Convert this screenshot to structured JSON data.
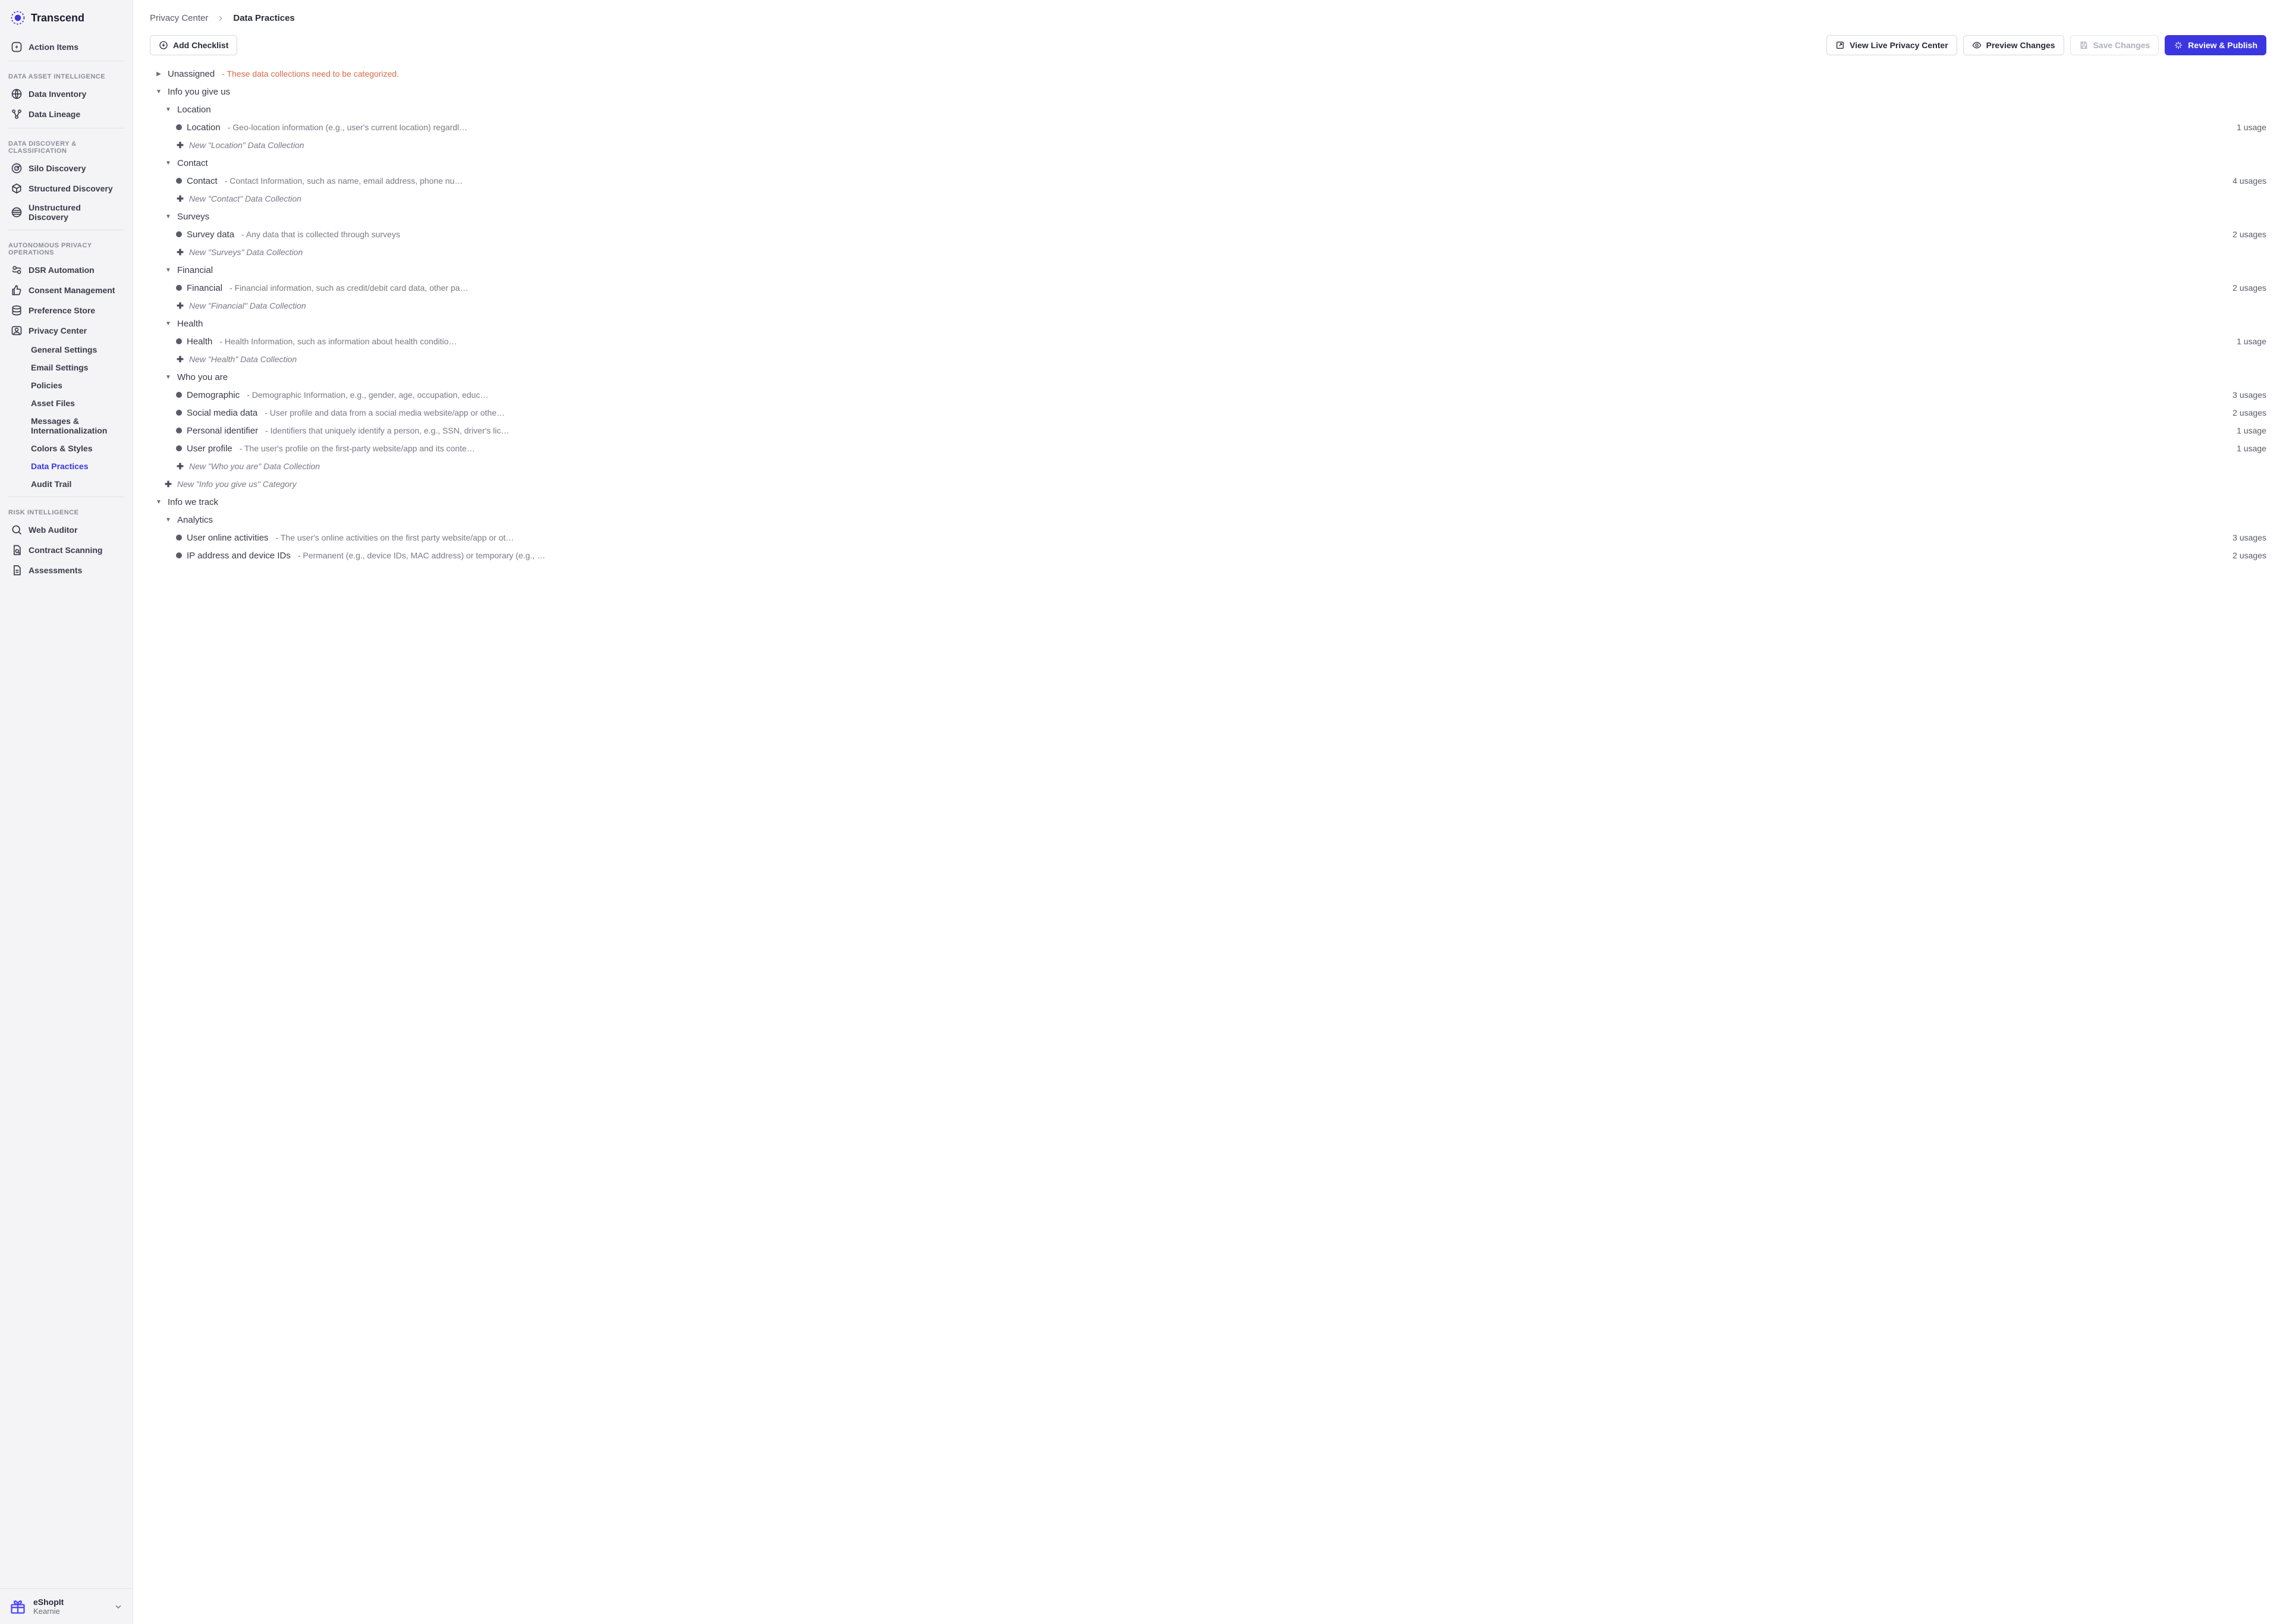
{
  "brand": "Transcend",
  "sidebar": {
    "action_items": "Action Items",
    "sections": [
      {
        "label": "DATA ASSET INTELLIGENCE",
        "items": [
          {
            "id": "data-inventory",
            "label": "Data Inventory"
          },
          {
            "id": "data-lineage",
            "label": "Data Lineage"
          }
        ]
      },
      {
        "label": "DATA DISCOVERY & CLASSIFICATION",
        "items": [
          {
            "id": "silo-discovery",
            "label": "Silo Discovery"
          },
          {
            "id": "structured-discovery",
            "label": "Structured Discovery"
          },
          {
            "id": "unstructured-discovery",
            "label": "Unstructured Discovery"
          }
        ]
      },
      {
        "label": "AUTONOMOUS PRIVACY OPERATIONS",
        "items": [
          {
            "id": "dsr-automation",
            "label": "DSR Automation"
          },
          {
            "id": "consent-management",
            "label": "Consent Management"
          },
          {
            "id": "preference-store",
            "label": "Preference Store"
          },
          {
            "id": "privacy-center",
            "label": "Privacy Center",
            "children": [
              "General Settings",
              "Email Settings",
              "Policies",
              "Asset Files",
              "Messages & Internationalization",
              "Colors & Styles",
              "Data Practices",
              "Audit Trail"
            ],
            "active_child": 6
          }
        ]
      },
      {
        "label": "RISK INTELLIGENCE",
        "items": [
          {
            "id": "web-auditor",
            "label": "Web Auditor"
          },
          {
            "id": "contract-scanning",
            "label": "Contract Scanning"
          },
          {
            "id": "assessments",
            "label": "Assessments"
          }
        ]
      }
    ]
  },
  "account": {
    "org": "eShopIt",
    "user": "Kearnie"
  },
  "breadcrumb": {
    "parent": "Privacy Center",
    "current": "Data Practices"
  },
  "buttons": {
    "add_checklist": "Add Checklist",
    "view_live": "View Live Privacy Center",
    "preview": "Preview Changes",
    "save": "Save Changes",
    "publish": "Review & Publish"
  },
  "tree": {
    "unassigned": {
      "label": "Unassigned",
      "note": "- These data collections need to be categorized."
    },
    "infoGive": {
      "label": "Info you give us",
      "newCategory": "New \"Info you give us\" Category",
      "groups": [
        {
          "label": "Location",
          "newColl": "New \"Location\" Data Collection",
          "items": [
            {
              "label": "Location",
              "desc": "- Geo-location information (e.g., user's current location) regardl…",
              "usage": "1 usage"
            }
          ]
        },
        {
          "label": "Contact",
          "newColl": "New \"Contact\" Data Collection",
          "items": [
            {
              "label": "Contact",
              "desc": "- Contact Information, such as name, email address, phone nu…",
              "usage": "4 usages"
            }
          ]
        },
        {
          "label": "Surveys",
          "newColl": "New \"Surveys\" Data Collection",
          "items": [
            {
              "label": "Survey data",
              "desc": "- Any data that is collected through surveys",
              "usage": "2 usages"
            }
          ]
        },
        {
          "label": "Financial",
          "newColl": "New \"Financial\" Data Collection",
          "items": [
            {
              "label": "Financial",
              "desc": "- Financial information, such as credit/debit card data, other pa…",
              "usage": "2 usages"
            }
          ]
        },
        {
          "label": "Health",
          "newColl": "New \"Health\" Data Collection",
          "items": [
            {
              "label": "Health",
              "desc": "- Health Information, such as information about health conditio…",
              "usage": "1 usage"
            }
          ]
        },
        {
          "label": "Who you are",
          "newColl": "New \"Who you are\" Data Collection",
          "items": [
            {
              "label": "Demographic",
              "desc": "- Demographic Information, e.g., gender, age, occupation, educ…",
              "usage": "3 usages"
            },
            {
              "label": "Social media data",
              "desc": "- User profile and data from a social media website/app or othe…",
              "usage": "2 usages"
            },
            {
              "label": "Personal identifier",
              "desc": "- Identifiers that uniquely identify a person, e.g., SSN, driver's lic…",
              "usage": "1 usage"
            },
            {
              "label": "User profile",
              "desc": "- The user's profile on the first-party website/app and its conte…",
              "usage": "1 usage"
            }
          ]
        }
      ]
    },
    "infoTrack": {
      "label": "Info we track",
      "groups": [
        {
          "label": "Analytics",
          "items": [
            {
              "label": "User online activities",
              "desc": "- The user's online activities on the first party website/app or ot…",
              "usage": "3 usages"
            },
            {
              "label": "IP address and device IDs",
              "desc": "- Permanent (e.g., device IDs, MAC address) or temporary (e.g., …",
              "usage": "2 usages"
            }
          ]
        }
      ]
    }
  }
}
